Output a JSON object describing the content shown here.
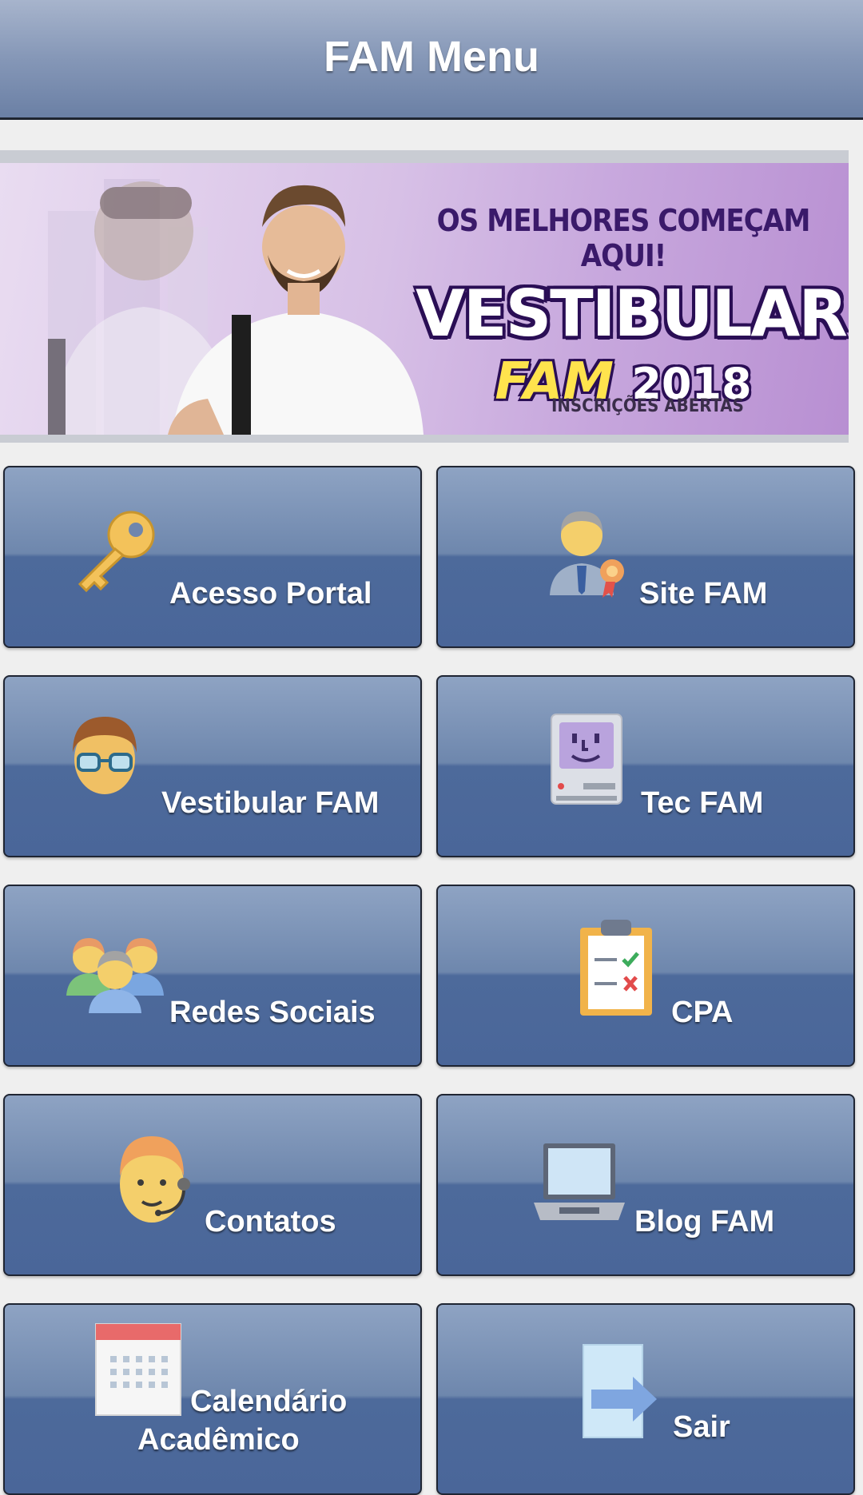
{
  "header": {
    "title": "FAM Menu"
  },
  "banner": {
    "tagline": "OS MELHORES COMEÇAM AQUI!",
    "headline": "VESTIBULAR",
    "brand": "FAM",
    "year": "2018",
    "footnote": "INSCRIÇÕES ABERTAS"
  },
  "menu": [
    {
      "label": "Acesso Portal",
      "icon": "key-icon"
    },
    {
      "label": "Site FAM",
      "icon": "award-person-icon"
    },
    {
      "label": "Vestibular FAM",
      "icon": "student-icon"
    },
    {
      "label": "Tec FAM",
      "icon": "retro-computer-icon"
    },
    {
      "label": "Redes Sociais",
      "icon": "group-icon"
    },
    {
      "label": "CPA",
      "icon": "clipboard-checklist-icon"
    },
    {
      "label": "Contatos",
      "icon": "support-agent-icon"
    },
    {
      "label": "Blog FAM",
      "icon": "laptop-icon"
    },
    {
      "label_line1": "Calendário",
      "label_line2": "Acadêmico",
      "icon": "calendar-icon"
    },
    {
      "label": "Sair",
      "icon": "exit-icon"
    }
  ]
}
